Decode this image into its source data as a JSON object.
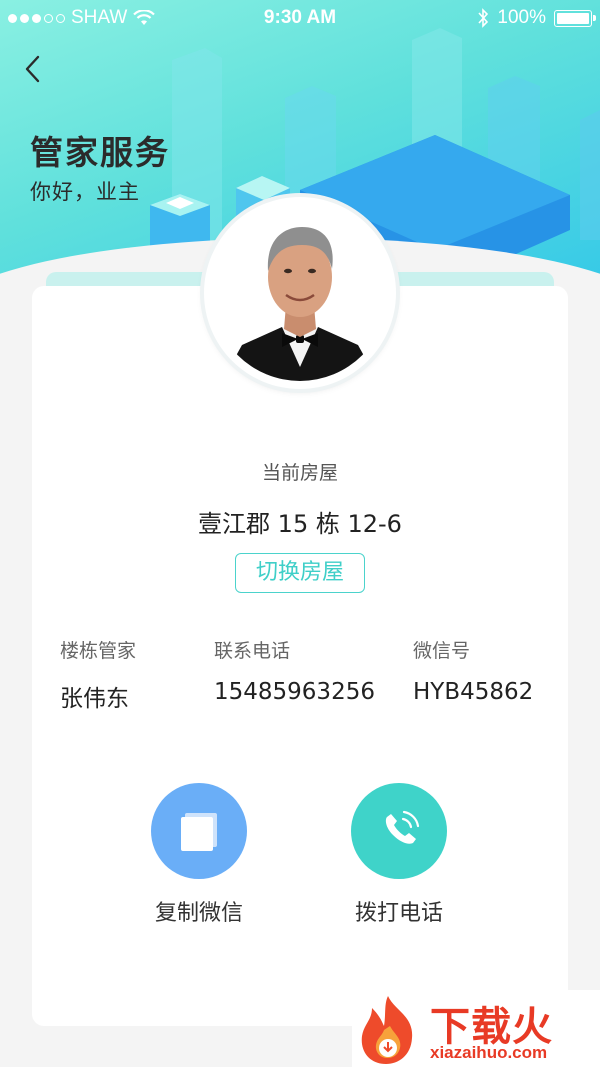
{
  "status_bar": {
    "carrier": "SHAW",
    "time": "9:30 AM",
    "battery": "100%",
    "battery_level": 1.0
  },
  "header": {
    "title": "管家服务",
    "subtitle": "你好，业主"
  },
  "house": {
    "label": "当前房屋",
    "value": "壹江郡 15 栋 12-6",
    "switch_label": "切换房屋"
  },
  "info": [
    {
      "heading": "楼栋管家",
      "value": "张伟东"
    },
    {
      "heading": "联系电话",
      "value": "15485963256"
    },
    {
      "heading": "微信号",
      "value": "HYB45862"
    }
  ],
  "actions": [
    {
      "label": "复制微信",
      "icon": "copy-icon",
      "color": "#6aaef7"
    },
    {
      "label": "拨打电话",
      "icon": "phone-icon",
      "color": "#3fd3c9"
    }
  ],
  "watermark": {
    "brand": "下载火",
    "url": "xiazaihuo.com"
  },
  "colors": {
    "accent": "#3fcfc8",
    "blue": "#6aaef7"
  }
}
